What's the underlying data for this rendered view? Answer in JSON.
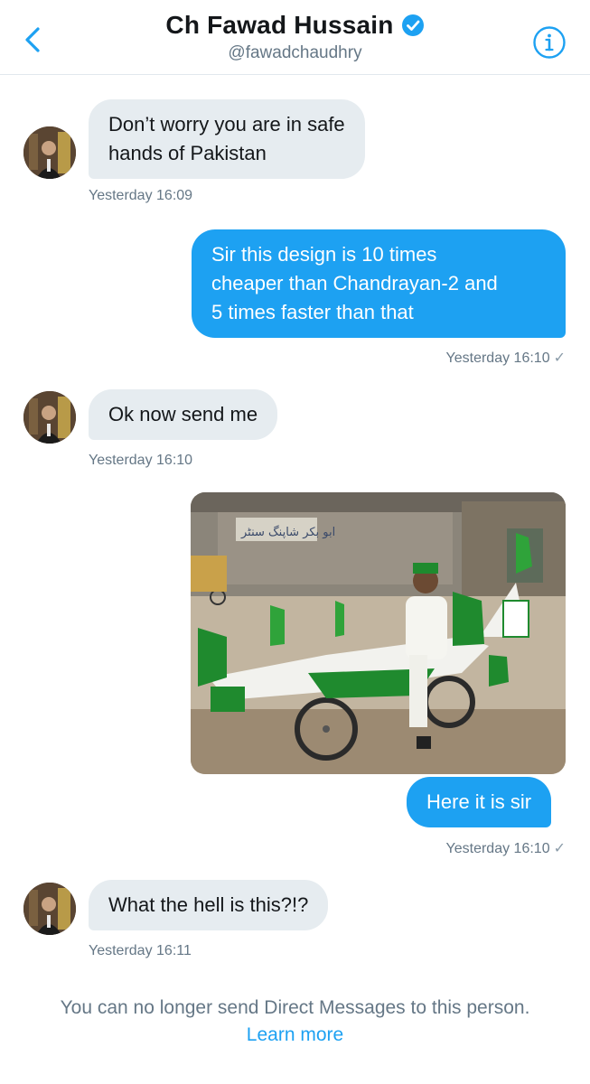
{
  "header": {
    "name": "Ch Fawad Hussain",
    "handle": "@fawadchaudhry"
  },
  "messages": [
    {
      "lines": [
        "Don’t worry you are in safe",
        "hands of Pakistan"
      ],
      "time": "Yesterday 16:09"
    },
    {
      "lines": [
        "Sir this design is 10 times",
        "cheaper than Chandrayan-2 and",
        "5 times faster than that"
      ],
      "time": "Yesterday 16:10"
    },
    {
      "lines": [
        "Ok now send me"
      ],
      "time": "Yesterday 16:10"
    },
    {
      "lines": [
        "Here it is sir"
      ],
      "time": "Yesterday 16:10"
    },
    {
      "lines": [
        "What the hell is this?!?"
      ],
      "time": "Yesterday 16:11"
    }
  ],
  "photo": {
    "shop_sign": "ابو بکر شاپنگ سنٹر"
  },
  "footer": {
    "notice": "You can no longer send Direct Messages to this person.",
    "learn_more": "Learn more"
  },
  "colors": {
    "accent": "#1da1f2",
    "incoming_bubble": "#e6ecf0",
    "muted_text": "#657786",
    "flag_green": "#1f8a2e"
  },
  "icons": {
    "back": "chevron-left-icon",
    "verified": "verified-badge-icon",
    "info": "info-icon",
    "read_receipt": "check-icon"
  }
}
